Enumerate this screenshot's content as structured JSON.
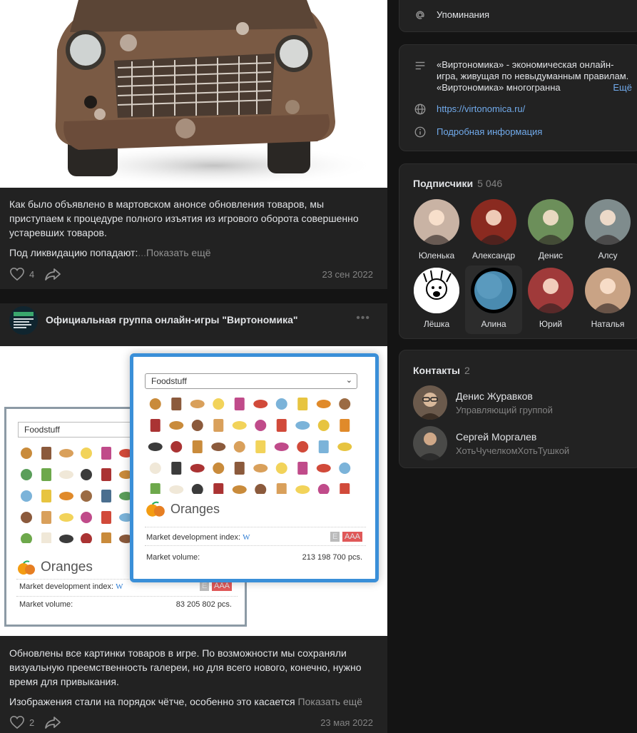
{
  "post1": {
    "text": "Как было объявлено в мартовском анонсе обновления товаров, мы приступаем к процедуре полного изъятия из игрового оборота совершенно устаревших товаров.",
    "preview": "Под ликвидацию попадают:",
    "ellipsis": "...",
    "show_more": "Показать ещё",
    "likes": "4",
    "date": "23 сен 2022"
  },
  "post2": {
    "group_name": "Официальная группа онлайн-игры \"Виртономика\"",
    "text": "Обновлены все картинки товаров в игре. По возможности мы сохраняли визуальную преемственность галереи, но для всего нового, конечно, нужно время для привыкания.",
    "preview": "Изображения стали на порядок чётче, особенно это касается",
    "show_more": "Показать ещё",
    "likes": "2",
    "date": "23 мая 2022",
    "image": {
      "back": {
        "select": "Foodstuff",
        "product": "Oranges",
        "mdi_label": "Market development index:",
        "mdi_w": "W",
        "grade_e": "E",
        "grade_sep": "-",
        "grade_aaa": "AAA",
        "mv_label": "Market volume:",
        "mv_value": "83 205 802 pcs."
      },
      "front": {
        "select": "Foodstuff",
        "product": "Oranges",
        "mdi_label": "Market development index:",
        "mdi_w": "W",
        "grade_e": "E",
        "grade_sep": "-",
        "grade_aaa": "AAA",
        "mv_label": "Market volume:",
        "mv_value": "213 198 700 pcs."
      }
    }
  },
  "sidebar": {
    "mentions": "Упоминания",
    "description": "«Виртономика» - экономическая онлайн-игра, живущая по невыдуманным правилам. «Виртономика» многогранна",
    "description_more": "Ещё",
    "website": "https://virtonomica.ru/",
    "details": "Подробная информация",
    "subscribers_title": "Подписчики",
    "subscribers_count": "5 046",
    "subscribers": [
      {
        "name": "Юленька",
        "color": "#c9b3a4"
      },
      {
        "name": "Александр",
        "color": "#8a2a20"
      },
      {
        "name": "Денис",
        "color": "#6c8f5a"
      },
      {
        "name": "Алсу",
        "color": "#7f8c8d"
      },
      {
        "name": "Лёшка",
        "color": "#f2f2f2"
      },
      {
        "name": "Алина",
        "color": "#3c6b86"
      },
      {
        "name": "Юрий",
        "color": "#a03a3a"
      },
      {
        "name": "Наталья",
        "color": "#c9a385"
      }
    ],
    "contacts_title": "Контакты",
    "contacts_count": "2",
    "contacts": [
      {
        "name": "Денис Журавков",
        "role": "Управляющий группой"
      },
      {
        "name": "Сергей Моргалев",
        "role": "ХотьЧучелкомХотьТушкой"
      }
    ]
  },
  "colors": {
    "accent": "#71aaeb",
    "background": "#141414",
    "panel": "#222222"
  }
}
